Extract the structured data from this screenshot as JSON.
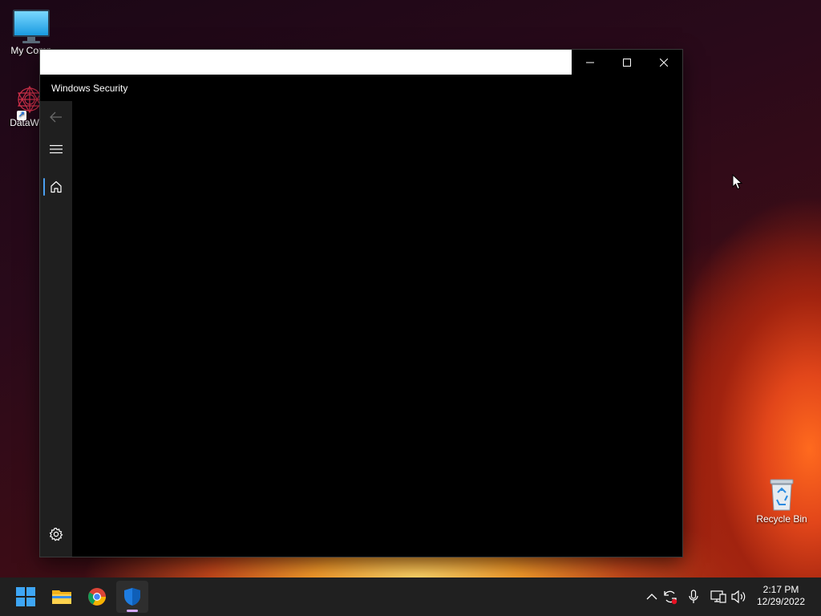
{
  "desktop": {
    "icons": [
      {
        "label": "My Comp",
        "icon": "monitor-icon"
      },
      {
        "label": "DataWag",
        "icon": "datawag-icon"
      },
      {
        "label": "Recycle Bin",
        "icon": "recycle-bin-icon"
      }
    ]
  },
  "window": {
    "app_title": "Windows Security",
    "caption": {
      "minimize_icon": "minimize-icon",
      "maximize_icon": "maximize-icon",
      "close_icon": "close-icon"
    },
    "nav": {
      "back_icon": "back-arrow-icon",
      "menu_icon": "hamburger-menu-icon",
      "home_icon": "home-icon",
      "settings_icon": "gear-icon",
      "accent_color": "#4ba0f0"
    }
  },
  "taskbar": {
    "apps": [
      "start-icon",
      "file-explorer-icon",
      "chrome-icon",
      "windows-security-icon"
    ],
    "tray": [
      "chevron-up-icon",
      "sync-icon",
      "microphone-icon",
      "network-icon",
      "volume-icon"
    ],
    "time": "2:17 PM",
    "date": "12/29/2022"
  },
  "colors": {
    "taskbar_bg": "#202020",
    "window_bg": "#000000",
    "rail_bg": "#1f1f1f"
  }
}
